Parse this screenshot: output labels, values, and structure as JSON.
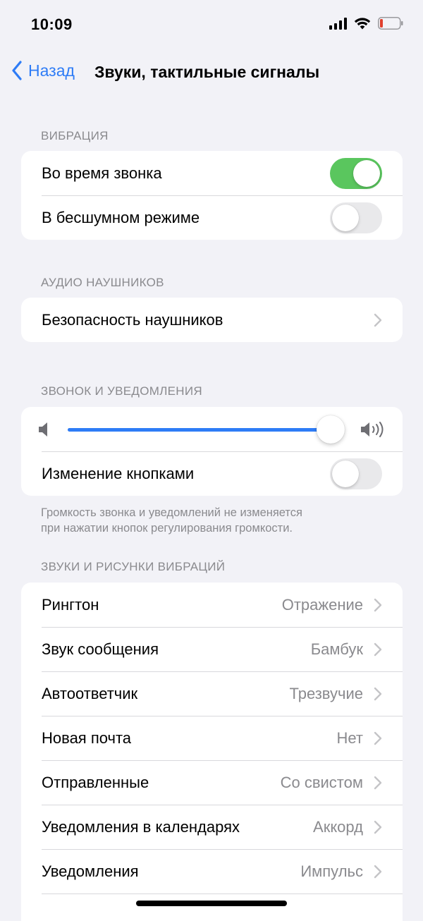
{
  "status_bar": {
    "time": "10:09"
  },
  "nav": {
    "back_label": "Назад",
    "title": "Звуки, тактильные сигналы"
  },
  "vibration": {
    "header": "ВИБРАЦИЯ",
    "items": [
      {
        "label": "Во время звонка",
        "on": true
      },
      {
        "label": "В бесшумном режиме",
        "on": false
      }
    ]
  },
  "headphone_audio": {
    "header": "АУДИО НАУШНИКОВ",
    "items": [
      {
        "label": "Безопасность наушников"
      }
    ]
  },
  "ringer": {
    "header": "ЗВОНОК И УВЕДОМЛЕНИЯ",
    "volume_level": 0.95,
    "change_with_buttons": {
      "label": "Изменение кнопками",
      "on": false
    },
    "note_line1": "Громкость звонка и уведомлений не изменяется",
    "note_line2": "при нажатии кнопок регулирования громкости."
  },
  "sounds": {
    "header": "ЗВУКИ И РИСУНКИ ВИБРАЦИЙ",
    "items": [
      {
        "label": "Рингтон",
        "value": "Отражение"
      },
      {
        "label": "Звук сообщения",
        "value": "Бамбук"
      },
      {
        "label": "Автоответчик",
        "value": "Трезвучие"
      },
      {
        "label": "Новая почта",
        "value": "Нет"
      },
      {
        "label": "Отправленные",
        "value": "Со свистом"
      },
      {
        "label": "Уведомления в календарях",
        "value": "Аккорд"
      },
      {
        "label": "Уведомления",
        "value": "Импульс"
      }
    ]
  },
  "colors": {
    "accent": "#2e7cf6",
    "toggle_on": "#5ac65e",
    "background": "#f2f2f7"
  }
}
